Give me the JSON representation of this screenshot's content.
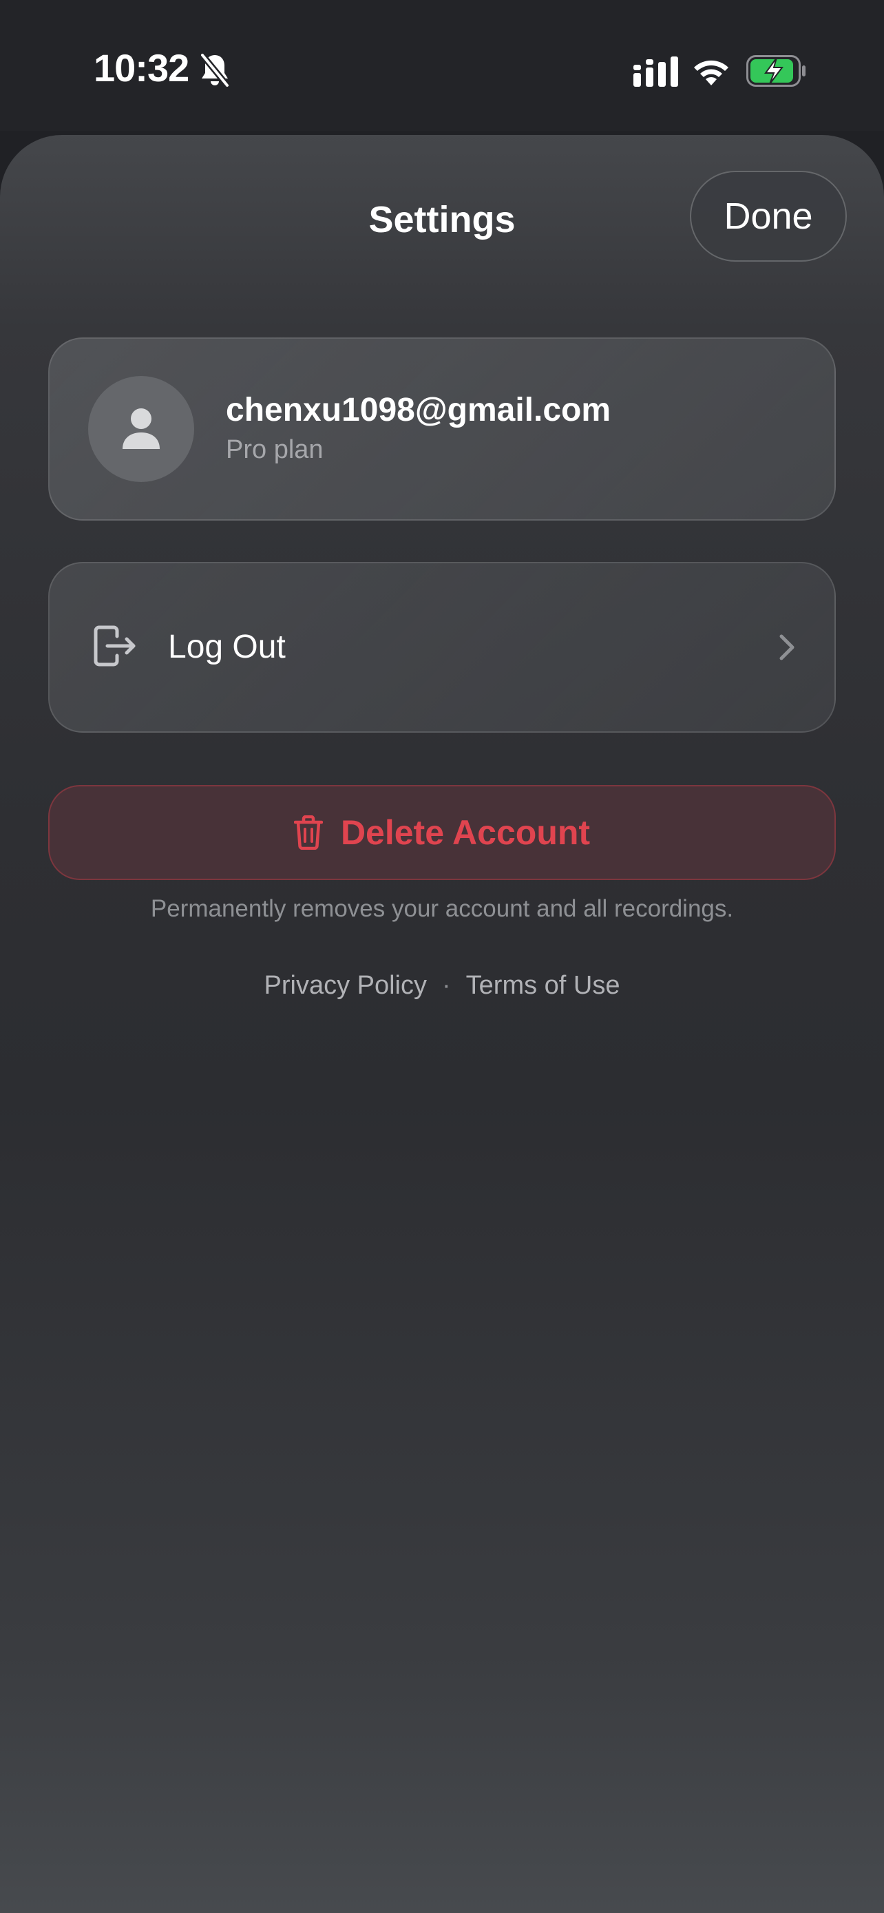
{
  "status_bar": {
    "time": "10:32",
    "icons": [
      "bell-slash-icon",
      "signal-icon",
      "wifi-icon",
      "battery-charging-icon"
    ],
    "battery_color": "#34c759"
  },
  "header": {
    "title": "Settings",
    "done_label": "Done"
  },
  "account": {
    "email": "chenxu1098@gmail.com",
    "plan": "Pro plan",
    "avatar_icon": "person-icon"
  },
  "logout": {
    "label": "Log Out",
    "icon": "logout-icon",
    "chevron": "chevron-right-icon"
  },
  "delete_account": {
    "label": "Delete Account",
    "icon": "trash-icon",
    "note": "Permanently removes your account and all recordings.",
    "color": "#e0444f"
  },
  "footer": {
    "privacy_label": "Privacy Policy",
    "separator": "·",
    "terms_label": "Terms of Use"
  }
}
